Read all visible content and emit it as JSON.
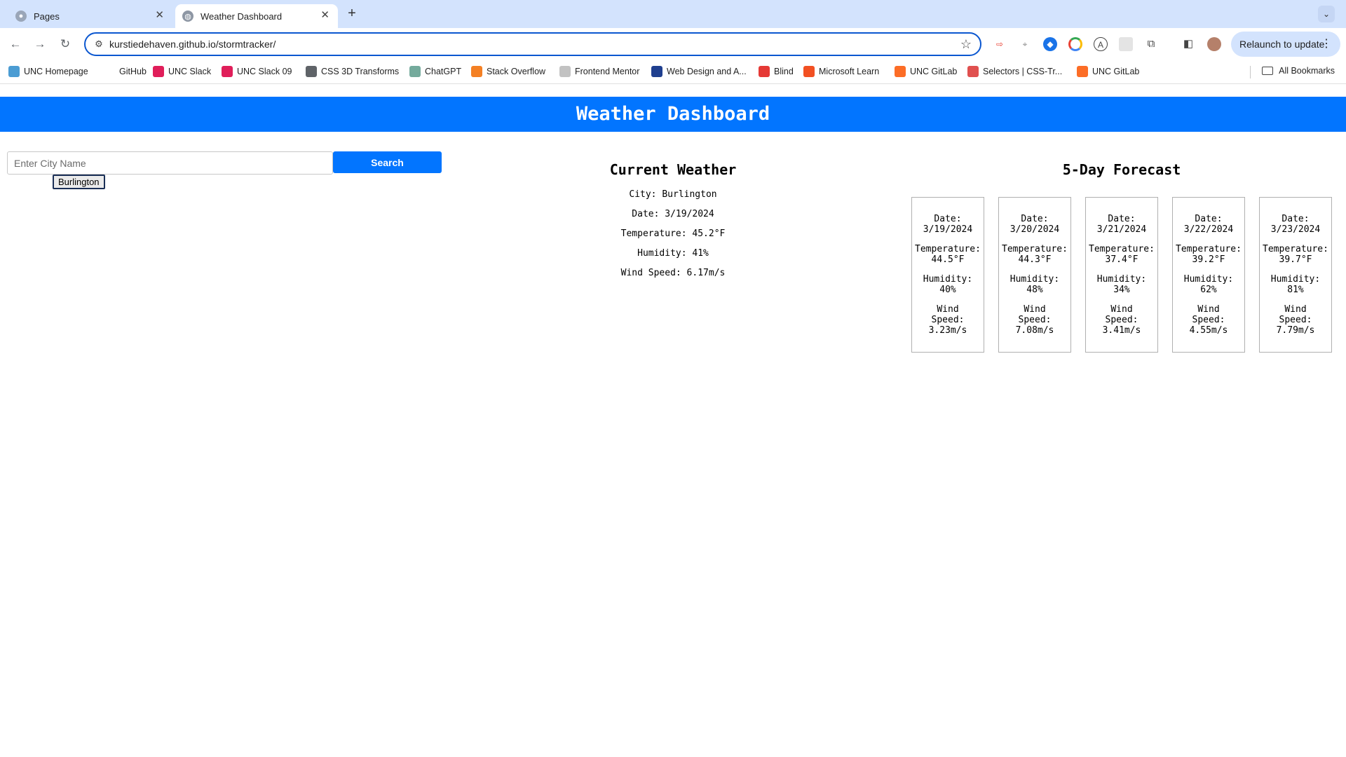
{
  "browser": {
    "tabs": [
      {
        "title": "Pages",
        "active": false
      },
      {
        "title": "Weather Dashboard",
        "active": true
      }
    ],
    "url": "kurstiedehaven.github.io/stormtracker/",
    "relaunch_label": "Relaunch to update",
    "bookmarks": [
      {
        "label": "UNC Homepage",
        "icon": "unc-icon",
        "color": "#4b9cd3"
      },
      {
        "label": "GitHub",
        "icon": "github-icon",
        "color": "#ffffff"
      },
      {
        "label": "UNC Slack",
        "icon": "slack-icon",
        "color": "#e01e5a"
      },
      {
        "label": "UNC Slack 09",
        "icon": "slack-icon",
        "color": "#e01e5a"
      },
      {
        "label": "CSS 3D Transforms",
        "icon": "globe-icon",
        "color": "#5f6368"
      },
      {
        "label": "ChatGPT",
        "icon": "chatgpt-icon",
        "color": "#74aa9c"
      },
      {
        "label": "Stack Overflow",
        "icon": "stackoverflow-icon",
        "color": "#f48024"
      },
      {
        "label": "Frontend Mentor",
        "icon": "frontend-mentor-icon",
        "color": "#c2c2c2"
      },
      {
        "label": "Web Design and A...",
        "icon": "w3-icon",
        "color": "#1f3f8f"
      },
      {
        "label": "Blind",
        "icon": "blind-icon",
        "color": "#e53935"
      },
      {
        "label": "Microsoft Learn",
        "icon": "microsoft-icon",
        "color": "#f25022"
      },
      {
        "label": "UNC GitLab",
        "icon": "gitlab-icon",
        "color": "#fc6d26"
      },
      {
        "label": "Selectors | CSS-Tr...",
        "icon": "csstricks-icon",
        "color": "#e0504f"
      },
      {
        "label": "UNC GitLab",
        "icon": "gitlab-icon",
        "color": "#fc6d26"
      }
    ],
    "all_bookmarks_label": "All Bookmarks"
  },
  "header": {
    "title": "Weather Dashboard"
  },
  "search": {
    "placeholder": "Enter City Name",
    "value": "",
    "button_label": "Search",
    "history": [
      "Burlington"
    ]
  },
  "current": {
    "title": "Current Weather",
    "city": "City: Burlington",
    "date": "Date: 3/19/2024",
    "temperature": "Temperature: 45.2°F",
    "humidity": "Humidity: 41%",
    "wind": "Wind Speed: 6.17m/s"
  },
  "forecast": {
    "title": "5-Day Forecast",
    "days": [
      {
        "date_label": "Date:",
        "date": "3/19/2024",
        "temp_label": "Temperature:",
        "temp": "44.5°F",
        "hum_label": "Humidity:",
        "hum": "40%",
        "wind_label1": "Wind",
        "wind_label2": "Speed:",
        "wind": "3.23m/s"
      },
      {
        "date_label": "Date:",
        "date": "3/20/2024",
        "temp_label": "Temperature:",
        "temp": "44.3°F",
        "hum_label": "Humidity:",
        "hum": "48%",
        "wind_label1": "Wind",
        "wind_label2": "Speed:",
        "wind": "7.08m/s"
      },
      {
        "date_label": "Date:",
        "date": "3/21/2024",
        "temp_label": "Temperature:",
        "temp": "37.4°F",
        "hum_label": "Humidity:",
        "hum": "34%",
        "wind_label1": "Wind",
        "wind_label2": "Speed:",
        "wind": "3.41m/s"
      },
      {
        "date_label": "Date:",
        "date": "3/22/2024",
        "temp_label": "Temperature:",
        "temp": "39.2°F",
        "hum_label": "Humidity:",
        "hum": "62%",
        "wind_label1": "Wind",
        "wind_label2": "Speed:",
        "wind": "4.55m/s"
      },
      {
        "date_label": "Date:",
        "date": "3/23/2024",
        "temp_label": "Temperature:",
        "temp": "39.7°F",
        "hum_label": "Humidity:",
        "hum": "81%",
        "wind_label1": "Wind",
        "wind_label2": "Speed:",
        "wind": "7.79m/s"
      }
    ]
  },
  "colors": {
    "accent": "#0275ff",
    "tabstrip": "#d3e3fd",
    "omnibox_border": "#0b57d0"
  }
}
